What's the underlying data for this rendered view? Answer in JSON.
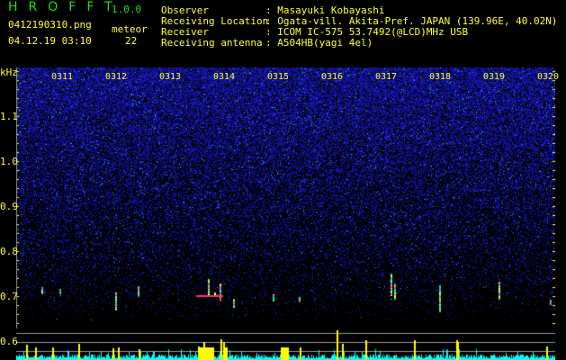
{
  "app": {
    "title": "HROFFT",
    "version": "1.0.0"
  },
  "file": {
    "name": "0412190310.png",
    "datetime": "04.12.19 03:10"
  },
  "meteor": {
    "label": "meteor",
    "count": "22"
  },
  "info": [
    {
      "label": "Observer",
      "value": "Masayuki Kobayashi"
    },
    {
      "label": "Receiving Location",
      "value": "Ogata-vill. Akita-Pref. JAPAN (139.96E, 40.02N)"
    },
    {
      "label": "Receiver",
      "value": "ICOM IC-575 53.7492(@LCD)MHz USB"
    },
    {
      "label": "Receiving antenna",
      "value": "A504HB(yagi 4el)"
    }
  ],
  "yaxis": {
    "unit": "kHz",
    "ticks": [
      "1.1",
      "1.0",
      "0.9",
      "0.8",
      "0.7",
      "0.6"
    ]
  },
  "time_labels": [
    "0311",
    "0312",
    "0313",
    "0314",
    "0315",
    "0316",
    "0317",
    "0318",
    "0319",
    "0320"
  ],
  "colors": {
    "text": "#ffff33",
    "title": "#22dd22",
    "noise": "#2222cc",
    "bar_base": "#00ffff",
    "bar_meteor": "#ffff00"
  }
}
